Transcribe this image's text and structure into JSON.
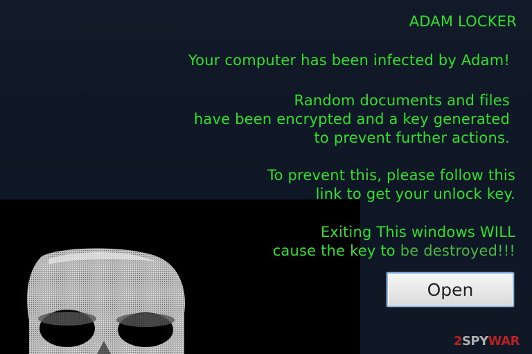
{
  "window": {
    "title": "ADAM LOCKER"
  },
  "message": {
    "infected": "Your computer has been infected by Adam!",
    "random_lines": [
      "Random documents and files",
      "have been encrypted and a key generated",
      "to prevent further actions."
    ],
    "prevent_lines": [
      "To prevent this, please follow this",
      "link to get your unlock key."
    ],
    "exiting_line1": "Exiting This windows WILL",
    "exiting_line2_a": "cause the key to ",
    "exiting_line2_b": "be destroyed!!!"
  },
  "buttons": {
    "open_label": "Open"
  },
  "watermark": {
    "lead": "2",
    "name_a": "SPY",
    "name_b": "WAR"
  },
  "colors": {
    "text": "#2fe02f",
    "background": "#121a29",
    "skull_panel": "#000000"
  },
  "icons": {
    "skull": "skull-icon"
  }
}
